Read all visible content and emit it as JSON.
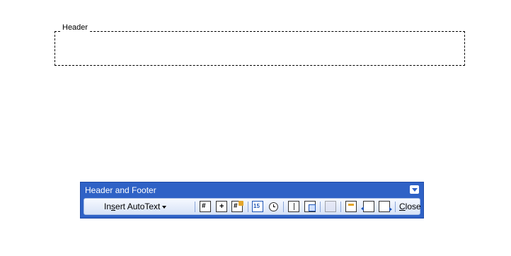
{
  "document": {
    "header_label": "Header"
  },
  "toolbar": {
    "title": "Header and Footer",
    "insert_autotext_pre": "In",
    "insert_autotext_underline": "s",
    "insert_autotext_post": "ert AutoText",
    "close_underline": "C",
    "close_rest": "lose",
    "icons": [
      "insert-page-number-icon",
      "insert-number-of-pages-icon",
      "format-page-number-icon",
      "insert-date-icon",
      "insert-time-icon",
      "page-setup-icon",
      "show-hide-document-text-icon",
      "link-to-previous-icon",
      "switch-header-footer-icon",
      "show-previous-icon",
      "show-next-icon"
    ],
    "accent_color": "#2f62c6"
  }
}
